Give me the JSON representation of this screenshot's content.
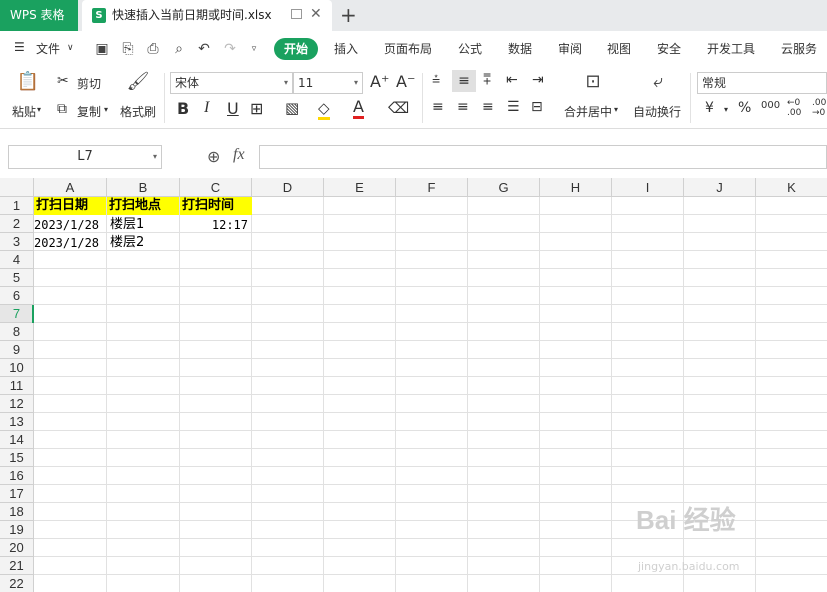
{
  "app": {
    "name": "WPS 表格"
  },
  "tab": {
    "file_name": "快速插入当前日期或时间.xlsx",
    "new_tab": "+"
  },
  "menu": {
    "file": "文件",
    "items": [
      "开始",
      "插入",
      "页面布局",
      "公式",
      "数据",
      "审阅",
      "视图",
      "安全",
      "开发工具",
      "云服务"
    ]
  },
  "ribbon": {
    "paste": "粘贴",
    "cut": "剪切",
    "copy": "复制",
    "format_painter": "格式刷",
    "font_name": "宋体",
    "font_size": "11",
    "merge_center": "合并居中",
    "wrap_text": "自动换行",
    "number_format": "常规",
    "currency": "¥",
    "percent": "%",
    "thousands": "000"
  },
  "formula_bar": {
    "cell_ref": "L7",
    "fx": "fx",
    "content": ""
  },
  "sheet": {
    "columns": [
      "A",
      "B",
      "C",
      "D",
      "E",
      "F",
      "G",
      "H",
      "I",
      "J",
      "K"
    ],
    "rows": [
      "1",
      "2",
      "3",
      "4",
      "5",
      "6",
      "7",
      "8",
      "9",
      "10",
      "11",
      "12",
      "13",
      "14",
      "15",
      "16",
      "17",
      "18",
      "19",
      "20",
      "21",
      "22"
    ],
    "selected_row": "7",
    "cells": {
      "A1": "打扫日期",
      "B1": "打扫地点",
      "C1": "打扫时间",
      "A2": "2023/1/28",
      "B2": "楼层1",
      "C2": "12:17",
      "A3": "2023/1/28",
      "B3": "楼层2"
    },
    "header_fill": "#ffff00"
  },
  "colors": {
    "brand": "#1aa15f"
  },
  "watermark": {
    "main": "Bai 经验",
    "sub": "jingyan.baidu.com"
  }
}
